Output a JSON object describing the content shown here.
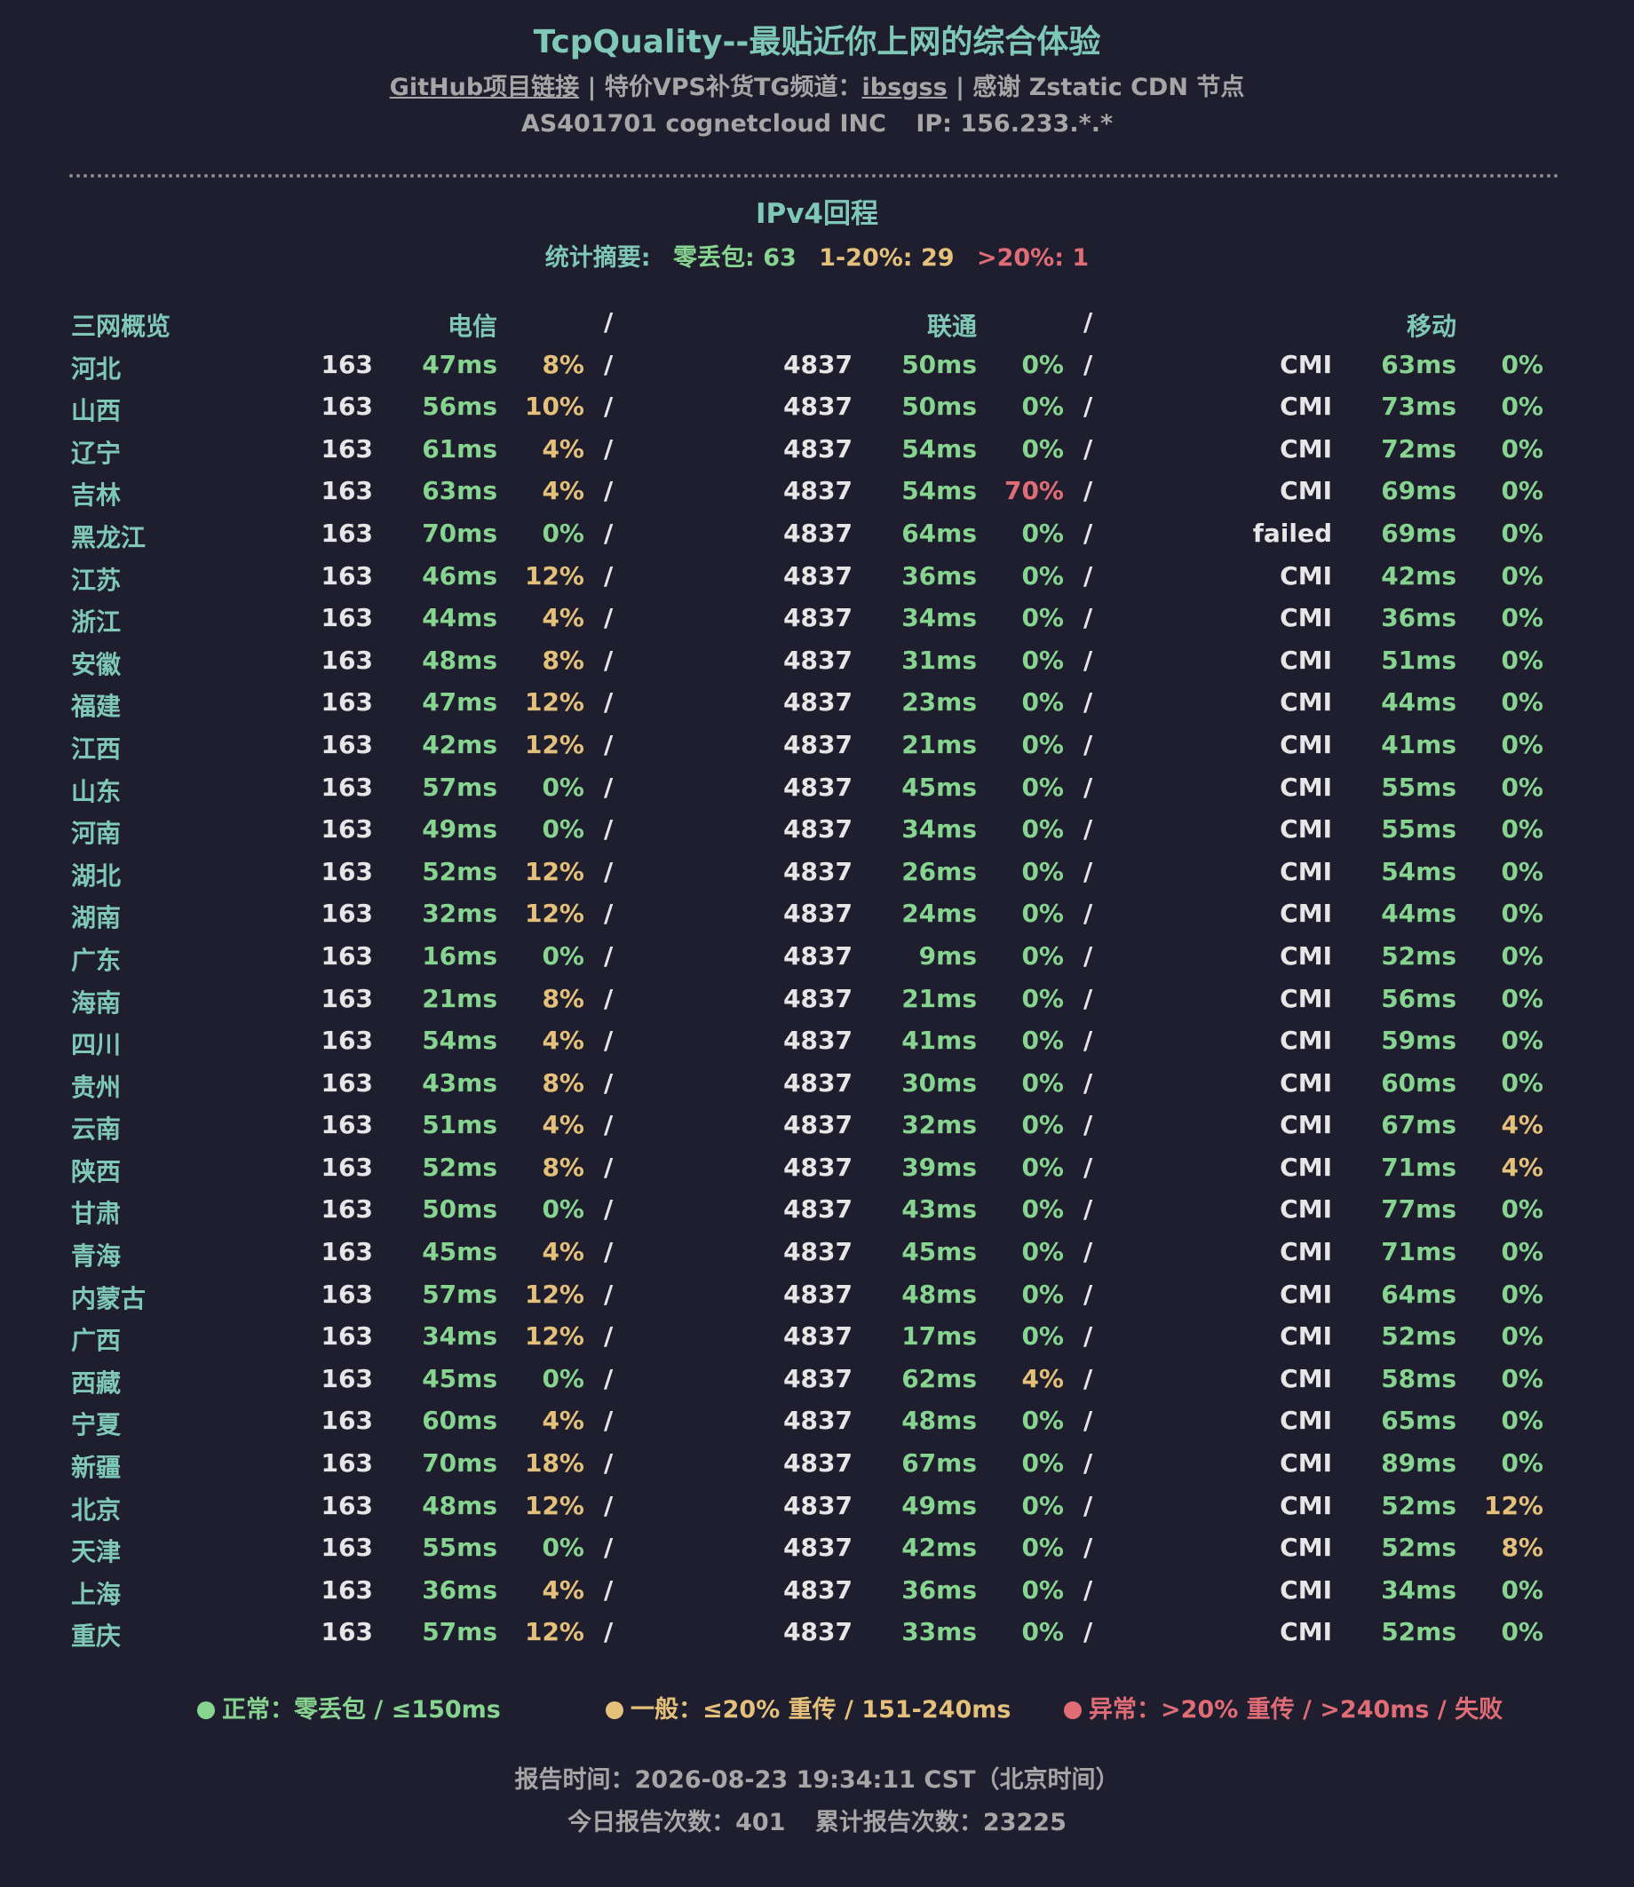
{
  "header": {
    "title": "TcpQuality--最贴近你上网的综合体验",
    "github_link": "GitHub项目链接",
    "sep": "|",
    "tg_prefix": "特价VPS补货TG频道：",
    "tg_link": "ibsgss",
    "cdn_text": "感谢 Zstatic CDN 节点",
    "as_info": "AS401701 cognetcloud INC",
    "ip_info": "IP: 156.233.*.*"
  },
  "section": {
    "title": "IPv4回程",
    "summary_label": "统计摘要:",
    "zero_loss": "零丢包: 63",
    "mid_loss": "1-20%: 29",
    "high_loss": ">20%: 1"
  },
  "table": {
    "headers": {
      "overview": "三网概览",
      "telecom": "电信",
      "unicom": "联通",
      "mobile": "移动",
      "sep": "/"
    },
    "rows": [
      {
        "province": "河北",
        "t_asn": "163",
        "t_lat": "47ms",
        "t_loss": "8%",
        "u_asn": "4837",
        "u_lat": "50ms",
        "u_loss": "0%",
        "m_asn": "CMI",
        "m_lat": "63ms",
        "m_loss": "0%"
      },
      {
        "province": "山西",
        "t_asn": "163",
        "t_lat": "56ms",
        "t_loss": "10%",
        "u_asn": "4837",
        "u_lat": "50ms",
        "u_loss": "0%",
        "m_asn": "CMI",
        "m_lat": "73ms",
        "m_loss": "0%"
      },
      {
        "province": "辽宁",
        "t_asn": "163",
        "t_lat": "61ms",
        "t_loss": "4%",
        "u_asn": "4837",
        "u_lat": "54ms",
        "u_loss": "0%",
        "m_asn": "CMI",
        "m_lat": "72ms",
        "m_loss": "0%"
      },
      {
        "province": "吉林",
        "t_asn": "163",
        "t_lat": "63ms",
        "t_loss": "4%",
        "u_asn": "4837",
        "u_lat": "54ms",
        "u_loss": "70%",
        "m_asn": "CMI",
        "m_lat": "69ms",
        "m_loss": "0%"
      },
      {
        "province": "黑龙江",
        "t_asn": "163",
        "t_lat": "70ms",
        "t_loss": "0%",
        "u_asn": "4837",
        "u_lat": "64ms",
        "u_loss": "0%",
        "m_asn": "failed",
        "m_lat": "69ms",
        "m_loss": "0%"
      },
      {
        "province": "江苏",
        "t_asn": "163",
        "t_lat": "46ms",
        "t_loss": "12%",
        "u_asn": "4837",
        "u_lat": "36ms",
        "u_loss": "0%",
        "m_asn": "CMI",
        "m_lat": "42ms",
        "m_loss": "0%"
      },
      {
        "province": "浙江",
        "t_asn": "163",
        "t_lat": "44ms",
        "t_loss": "4%",
        "u_asn": "4837",
        "u_lat": "34ms",
        "u_loss": "0%",
        "m_asn": "CMI",
        "m_lat": "36ms",
        "m_loss": "0%"
      },
      {
        "province": "安徽",
        "t_asn": "163",
        "t_lat": "48ms",
        "t_loss": "8%",
        "u_asn": "4837",
        "u_lat": "31ms",
        "u_loss": "0%",
        "m_asn": "CMI",
        "m_lat": "51ms",
        "m_loss": "0%"
      },
      {
        "province": "福建",
        "t_asn": "163",
        "t_lat": "47ms",
        "t_loss": "12%",
        "u_asn": "4837",
        "u_lat": "23ms",
        "u_loss": "0%",
        "m_asn": "CMI",
        "m_lat": "44ms",
        "m_loss": "0%"
      },
      {
        "province": "江西",
        "t_asn": "163",
        "t_lat": "42ms",
        "t_loss": "12%",
        "u_asn": "4837",
        "u_lat": "21ms",
        "u_loss": "0%",
        "m_asn": "CMI",
        "m_lat": "41ms",
        "m_loss": "0%"
      },
      {
        "province": "山东",
        "t_asn": "163",
        "t_lat": "57ms",
        "t_loss": "0%",
        "u_asn": "4837",
        "u_lat": "45ms",
        "u_loss": "0%",
        "m_asn": "CMI",
        "m_lat": "55ms",
        "m_loss": "0%"
      },
      {
        "province": "河南",
        "t_asn": "163",
        "t_lat": "49ms",
        "t_loss": "0%",
        "u_asn": "4837",
        "u_lat": "34ms",
        "u_loss": "0%",
        "m_asn": "CMI",
        "m_lat": "55ms",
        "m_loss": "0%"
      },
      {
        "province": "湖北",
        "t_asn": "163",
        "t_lat": "52ms",
        "t_loss": "12%",
        "u_asn": "4837",
        "u_lat": "26ms",
        "u_loss": "0%",
        "m_asn": "CMI",
        "m_lat": "54ms",
        "m_loss": "0%"
      },
      {
        "province": "湖南",
        "t_asn": "163",
        "t_lat": "32ms",
        "t_loss": "12%",
        "u_asn": "4837",
        "u_lat": "24ms",
        "u_loss": "0%",
        "m_asn": "CMI",
        "m_lat": "44ms",
        "m_loss": "0%"
      },
      {
        "province": "广东",
        "t_asn": "163",
        "t_lat": "16ms",
        "t_loss": "0%",
        "u_asn": "4837",
        "u_lat": "9ms",
        "u_loss": "0%",
        "m_asn": "CMI",
        "m_lat": "52ms",
        "m_loss": "0%"
      },
      {
        "province": "海南",
        "t_asn": "163",
        "t_lat": "21ms",
        "t_loss": "8%",
        "u_asn": "4837",
        "u_lat": "21ms",
        "u_loss": "0%",
        "m_asn": "CMI",
        "m_lat": "56ms",
        "m_loss": "0%"
      },
      {
        "province": "四川",
        "t_asn": "163",
        "t_lat": "54ms",
        "t_loss": "4%",
        "u_asn": "4837",
        "u_lat": "41ms",
        "u_loss": "0%",
        "m_asn": "CMI",
        "m_lat": "59ms",
        "m_loss": "0%"
      },
      {
        "province": "贵州",
        "t_asn": "163",
        "t_lat": "43ms",
        "t_loss": "8%",
        "u_asn": "4837",
        "u_lat": "30ms",
        "u_loss": "0%",
        "m_asn": "CMI",
        "m_lat": "60ms",
        "m_loss": "0%"
      },
      {
        "province": "云南",
        "t_asn": "163",
        "t_lat": "51ms",
        "t_loss": "4%",
        "u_asn": "4837",
        "u_lat": "32ms",
        "u_loss": "0%",
        "m_asn": "CMI",
        "m_lat": "67ms",
        "m_loss": "4%"
      },
      {
        "province": "陕西",
        "t_asn": "163",
        "t_lat": "52ms",
        "t_loss": "8%",
        "u_asn": "4837",
        "u_lat": "39ms",
        "u_loss": "0%",
        "m_asn": "CMI",
        "m_lat": "71ms",
        "m_loss": "4%"
      },
      {
        "province": "甘肃",
        "t_asn": "163",
        "t_lat": "50ms",
        "t_loss": "0%",
        "u_asn": "4837",
        "u_lat": "43ms",
        "u_loss": "0%",
        "m_asn": "CMI",
        "m_lat": "77ms",
        "m_loss": "0%"
      },
      {
        "province": "青海",
        "t_asn": "163",
        "t_lat": "45ms",
        "t_loss": "4%",
        "u_asn": "4837",
        "u_lat": "45ms",
        "u_loss": "0%",
        "m_asn": "CMI",
        "m_lat": "71ms",
        "m_loss": "0%"
      },
      {
        "province": "内蒙古",
        "t_asn": "163",
        "t_lat": "57ms",
        "t_loss": "12%",
        "u_asn": "4837",
        "u_lat": "48ms",
        "u_loss": "0%",
        "m_asn": "CMI",
        "m_lat": "64ms",
        "m_loss": "0%"
      },
      {
        "province": "广西",
        "t_asn": "163",
        "t_lat": "34ms",
        "t_loss": "12%",
        "u_asn": "4837",
        "u_lat": "17ms",
        "u_loss": "0%",
        "m_asn": "CMI",
        "m_lat": "52ms",
        "m_loss": "0%"
      },
      {
        "province": "西藏",
        "t_asn": "163",
        "t_lat": "45ms",
        "t_loss": "0%",
        "u_asn": "4837",
        "u_lat": "62ms",
        "u_loss": "4%",
        "m_asn": "CMI",
        "m_lat": "58ms",
        "m_loss": "0%"
      },
      {
        "province": "宁夏",
        "t_asn": "163",
        "t_lat": "60ms",
        "t_loss": "4%",
        "u_asn": "4837",
        "u_lat": "48ms",
        "u_loss": "0%",
        "m_asn": "CMI",
        "m_lat": "65ms",
        "m_loss": "0%"
      },
      {
        "province": "新疆",
        "t_asn": "163",
        "t_lat": "70ms",
        "t_loss": "18%",
        "u_asn": "4837",
        "u_lat": "67ms",
        "u_loss": "0%",
        "m_asn": "CMI",
        "m_lat": "89ms",
        "m_loss": "0%"
      },
      {
        "province": "北京",
        "t_asn": "163",
        "t_lat": "48ms",
        "t_loss": "12%",
        "u_asn": "4837",
        "u_lat": "49ms",
        "u_loss": "0%",
        "m_asn": "CMI",
        "m_lat": "52ms",
        "m_loss": "12%"
      },
      {
        "province": "天津",
        "t_asn": "163",
        "t_lat": "55ms",
        "t_loss": "0%",
        "u_asn": "4837",
        "u_lat": "42ms",
        "u_loss": "0%",
        "m_asn": "CMI",
        "m_lat": "52ms",
        "m_loss": "8%"
      },
      {
        "province": "上海",
        "t_asn": "163",
        "t_lat": "36ms",
        "t_loss": "4%",
        "u_asn": "4837",
        "u_lat": "36ms",
        "u_loss": "0%",
        "m_asn": "CMI",
        "m_lat": "34ms",
        "m_loss": "0%"
      },
      {
        "province": "重庆",
        "t_asn": "163",
        "t_lat": "57ms",
        "t_loss": "12%",
        "u_asn": "4837",
        "u_lat": "33ms",
        "u_loss": "0%",
        "m_asn": "CMI",
        "m_lat": "52ms",
        "m_loss": "0%"
      }
    ]
  },
  "legend": {
    "normal": "正常：零丢包 / ≤150ms",
    "medium": "一般：≤20% 重传 / 151-240ms",
    "abnormal": "异常：>20% 重传 / >240ms / 失败"
  },
  "footer": {
    "report_time": "报告时间：2026-08-23 19:34:11 CST（北京时间）",
    "today_count": "今日报告次数：401",
    "total_count": "累计报告次数：23225"
  },
  "colors": {
    "background": "#1e1e2e",
    "teal": "#7fc8b8",
    "green": "#86d48f",
    "yellow": "#e5c07b",
    "red": "#e06c75",
    "gray": "#a6a6a6"
  }
}
